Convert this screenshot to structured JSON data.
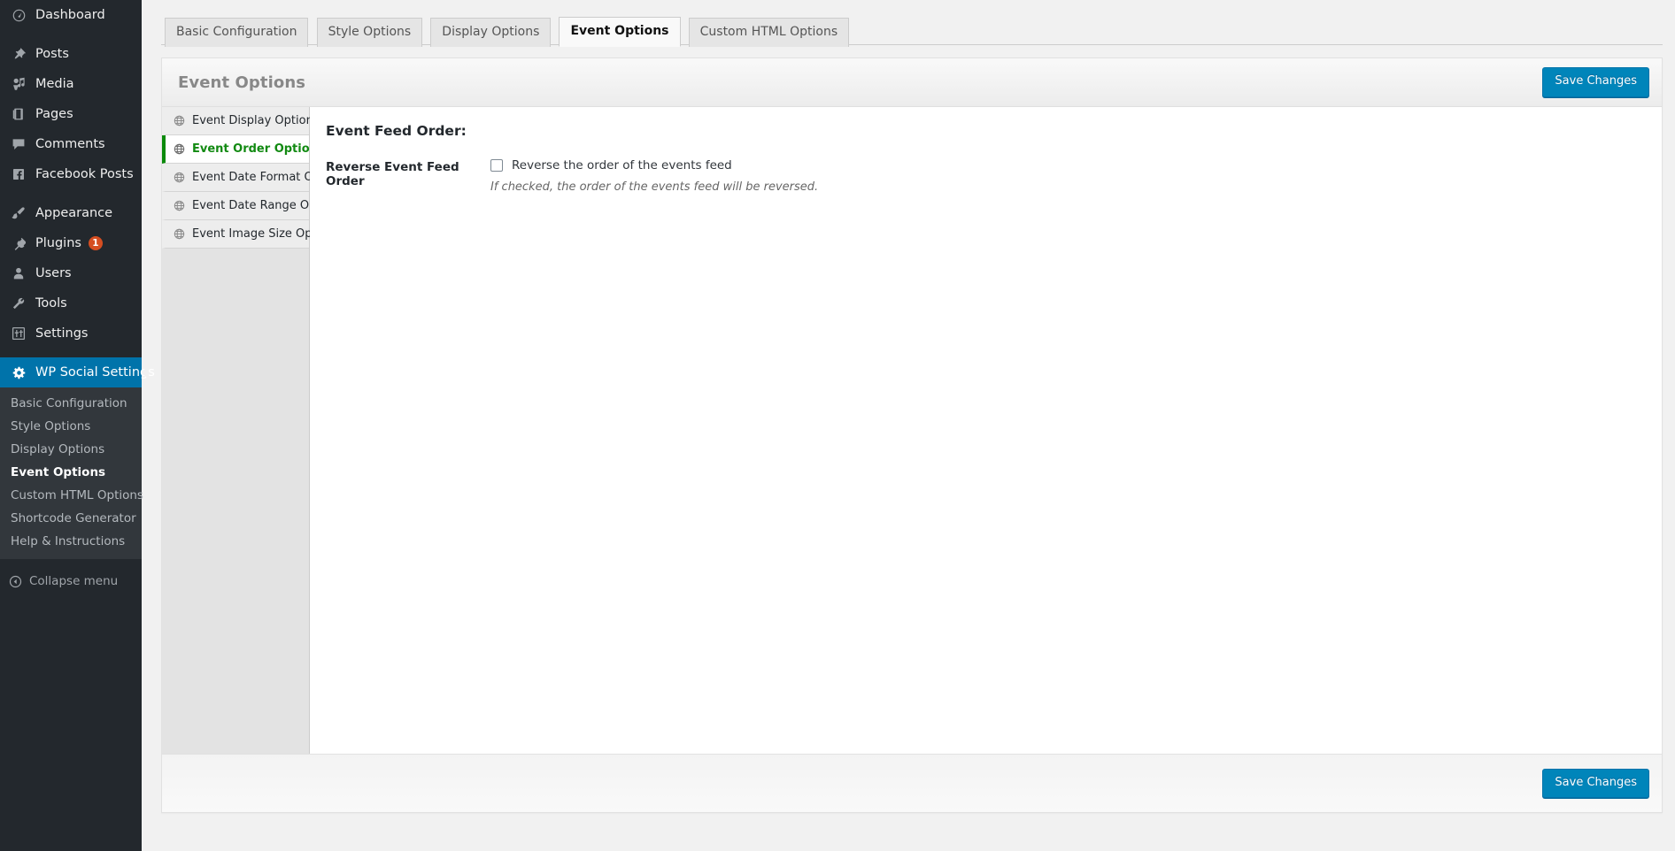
{
  "colors": {
    "sidebar_bg": "#23282d",
    "submenu_bg": "#32373c",
    "current_menu": "#0073aa",
    "badge": "#d54e21",
    "primary_button": "#0085ba",
    "active_option": "#128a12"
  },
  "sidebar": {
    "items": [
      {
        "label": "Dashboard",
        "icon": "dashboard-icon",
        "badge": null
      },
      {
        "label": "Posts",
        "icon": "pin-icon",
        "badge": null
      },
      {
        "label": "Media",
        "icon": "media-icon",
        "badge": null
      },
      {
        "label": "Pages",
        "icon": "pages-icon",
        "badge": null
      },
      {
        "label": "Comments",
        "icon": "comment-icon",
        "badge": null
      },
      {
        "label": "Facebook Posts",
        "icon": "facebook-icon",
        "badge": null
      },
      {
        "label": "Appearance",
        "icon": "paintbrush-icon",
        "badge": null
      },
      {
        "label": "Plugins",
        "icon": "plug-icon",
        "badge": "1"
      },
      {
        "label": "Users",
        "icon": "user-icon",
        "badge": null
      },
      {
        "label": "Tools",
        "icon": "wrench-icon",
        "badge": null
      },
      {
        "label": "Settings",
        "icon": "settings-sliders-icon",
        "badge": null
      },
      {
        "label": "WP Social Settings",
        "icon": "gear-icon",
        "badge": null
      }
    ],
    "submenu": [
      {
        "label": "Basic Configuration",
        "current": false
      },
      {
        "label": "Style Options",
        "current": false
      },
      {
        "label": "Display Options",
        "current": false
      },
      {
        "label": "Event Options",
        "current": true
      },
      {
        "label": "Custom HTML Options",
        "current": false
      },
      {
        "label": "Shortcode Generator",
        "current": false
      },
      {
        "label": "Help & Instructions",
        "current": false
      }
    ],
    "collapse_label": "Collapse menu"
  },
  "tabs": [
    {
      "label": "Basic Configuration",
      "active": false
    },
    {
      "label": "Style Options",
      "active": false
    },
    {
      "label": "Display Options",
      "active": false
    },
    {
      "label": "Event Options",
      "active": true
    },
    {
      "label": "Custom HTML Options",
      "active": false
    }
  ],
  "panel": {
    "title": "Event Options",
    "save_label_top": "Save Changes",
    "save_label_bottom": "Save Changes"
  },
  "option_nav": [
    {
      "label": "Event Display Options",
      "active": false
    },
    {
      "label": "Event Order Options",
      "active": true
    },
    {
      "label": "Event Date Format Options",
      "active": false
    },
    {
      "label": "Event Date Range Options",
      "active": false
    },
    {
      "label": "Event Image Size Options",
      "active": false
    }
  ],
  "form": {
    "section_heading": "Event Feed Order:",
    "rows": [
      {
        "label": "Reverse Event Feed Order",
        "checkbox_label": "Reverse the order of the events feed",
        "checked": false,
        "description": "If checked, the order of the events feed will be reversed."
      }
    ]
  }
}
